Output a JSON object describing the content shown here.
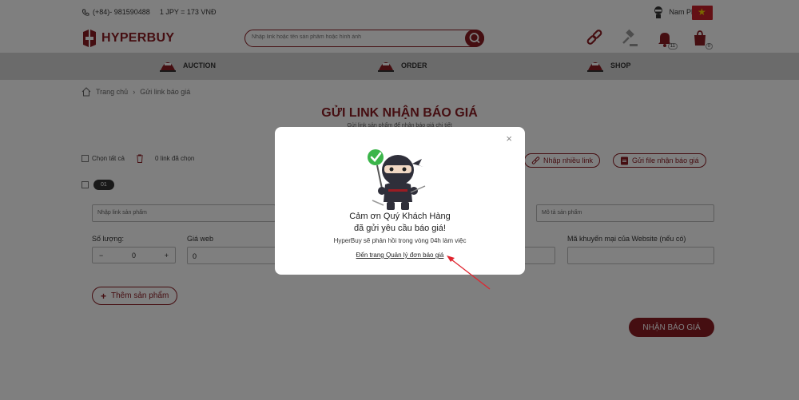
{
  "topbar": {
    "phone": "(+84)- 981590488",
    "rate": "1 JPY = 173 VNĐ",
    "user_name": "Nam Phương"
  },
  "header": {
    "brand": "HYPERBUY",
    "search_placeholder": "Nhập link hoặc tên sản phẩm hoặc hình ảnh",
    "notif_count": "11",
    "cart_count": "0"
  },
  "nav": {
    "items": [
      {
        "label": "AUCTION"
      },
      {
        "label": "ORDER"
      },
      {
        "label": "SHOP"
      }
    ]
  },
  "breadcrumb": {
    "home": "Trang chủ",
    "separator": "›",
    "current": "Gửi link báo giá"
  },
  "page": {
    "title": "GỬI LINK NHẬN BÁO GIÁ",
    "subtitle": "Gửi link sản phẩm để nhận báo giá chi tiết"
  },
  "toolbar": {
    "select_all": "Chọn tất cả",
    "selected_count": "0 link đã chọn",
    "multi_link": "Nhập nhiều link",
    "file_quote": "Gửi file nhận báo giá"
  },
  "row": {
    "tag": "01",
    "link_placeholder": "Nhập link sản phẩm",
    "desc_placeholder": "Mô tả sản phẩm",
    "qty_label": "Số lượng:",
    "qty_value": "0",
    "qty_minus": "−",
    "qty_plus": "+",
    "price_label": "Giá web",
    "price_value": "0",
    "promo_label": "Mã khuyến mại của Website (nếu có)"
  },
  "actions": {
    "add_product": "Thêm sản phẩm",
    "submit": "NHẬN BÁO GIÁ"
  },
  "modal": {
    "close": "×",
    "heading1": "Cảm ơn Quý Khách Hàng",
    "heading2": "đã gửi yêu cầu báo giá!",
    "description": "HyperBuy sẽ phản hồi trong vòng 04h làm việc",
    "link": "Đến trang Quản lý đơn báo giá"
  },
  "colors": {
    "brand": "#8b1c23",
    "overlay": "rgba(0,0,0,0.5)",
    "arrow": "#e0252f"
  }
}
